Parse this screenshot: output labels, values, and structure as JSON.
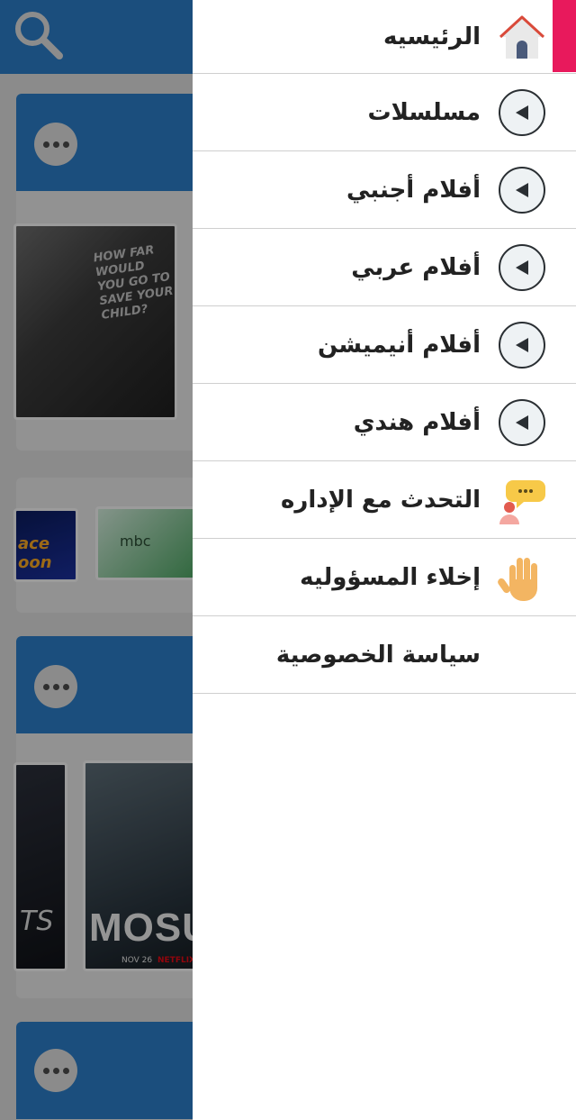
{
  "drawer": {
    "accent_color": "#e8195c",
    "items": [
      {
        "label": "الرئيسيه",
        "icon": "home-icon"
      },
      {
        "label": "مسلسلات",
        "icon": "expand-arrow-icon"
      },
      {
        "label": "أفلام أجنبي",
        "icon": "expand-arrow-icon"
      },
      {
        "label": "أفلام عربي",
        "icon": "expand-arrow-icon"
      },
      {
        "label": "أفلام أنيميشن",
        "icon": "expand-arrow-icon"
      },
      {
        "label": "أفلام هندي",
        "icon": "expand-arrow-icon"
      },
      {
        "label": "التحدث مع الإداره",
        "icon": "chat-admin-icon"
      },
      {
        "label": "إخلاء المسؤوليه",
        "icon": "raised-hand-icon"
      },
      {
        "label": "سياسة الخصوصية",
        "icon": ""
      }
    ]
  },
  "background": {
    "brand_color": "#2b7bc4",
    "posters": {
      "tagline": "HOW FAR WOULD YOU GO TO SAVE YOUR CHILD?",
      "spacetoon": "ace oon",
      "mbc": "mbc",
      "mosul_title": "MOSUL",
      "mosul_date": "NOV 26",
      "mosul_brand": "NETFLIX",
      "dark_text": "TS"
    }
  }
}
